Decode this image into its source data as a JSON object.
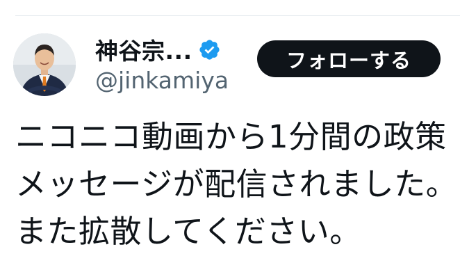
{
  "author": {
    "display_name": "神谷宗...",
    "handle": "@jinkamiya",
    "verified_icon": "verified-badge-icon",
    "verified_color": "#1d9bf0"
  },
  "follow_button": {
    "label": "フォローする",
    "background": "#0f1419",
    "text_color": "#ffffff"
  },
  "tweet": {
    "lines": [
      "ニコニコ動画から1分間の政策",
      "メッセージが配信されました。",
      "また拡散してください。"
    ]
  }
}
